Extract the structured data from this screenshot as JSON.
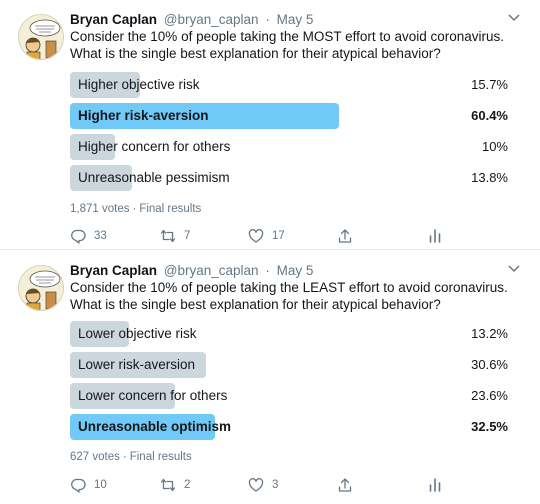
{
  "tweets": [
    {
      "name": "Bryan Caplan",
      "handle": "@bryan_caplan",
      "dot": "·",
      "date": "May 5",
      "text_line1": "Consider the 10% of people taking the MOST effort to avoid coronavirus.",
      "text_line2": "What is the single best explanation for their atypical behavior?",
      "poll": [
        {
          "label": "Higher objective risk",
          "pct": "15.7%",
          "share": 0.157,
          "winner": false
        },
        {
          "label": "Higher risk-aversion",
          "pct": "60.4%",
          "share": 0.604,
          "winner": true
        },
        {
          "label": "Higher concern for others",
          "pct": "10%",
          "share": 0.1,
          "winner": false
        },
        {
          "label": "Unreasonable pessimism",
          "pct": "13.8%",
          "share": 0.138,
          "winner": false
        }
      ],
      "votes": "1,871 votes",
      "sep": "·",
      "status": "Final results",
      "replies": "33",
      "retweets": "7",
      "likes": "17"
    },
    {
      "name": "Bryan Caplan",
      "handle": "@bryan_caplan",
      "dot": "·",
      "date": "May 5",
      "text_line1": "Consider the 10% of people taking the LEAST effort to avoid coronavirus.",
      "text_line2": "What is the single best explanation for their atypical behavior?",
      "poll": [
        {
          "label": "Lower objective risk",
          "pct": "13.2%",
          "share": 0.132,
          "winner": false
        },
        {
          "label": "Lower risk-aversion",
          "pct": "30.6%",
          "share": 0.306,
          "winner": false
        },
        {
          "label": "Lower concern for others",
          "pct": "23.6%",
          "share": 0.236,
          "winner": false
        },
        {
          "label": "Unreasonable optimism",
          "pct": "32.5%",
          "share": 0.325,
          "winner": true
        }
      ],
      "votes": "627 votes",
      "sep": "·",
      "status": "Final results",
      "replies": "10",
      "retweets": "2",
      "likes": "3"
    }
  ],
  "icons": {
    "avatar": "cartoon-avatar-icon",
    "more": "chevron-down-icon",
    "reply": "reply-icon",
    "retweet": "retweet-icon",
    "like": "heart-icon",
    "share": "share-icon",
    "analytics": "analytics-icon"
  },
  "colors": {
    "winner_bar": "#71c9f8",
    "other_bar": "#ccd6dd",
    "muted_text": "#657786",
    "icon": "#657786"
  }
}
